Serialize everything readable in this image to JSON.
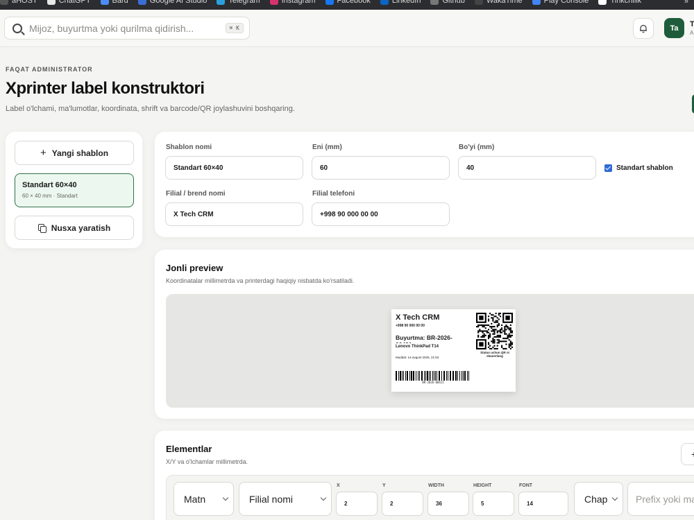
{
  "bookmarks": [
    {
      "label": "aHOST",
      "color": "#555555"
    },
    {
      "label": "ChatGPT",
      "color": "#e8e8e8"
    },
    {
      "label": "Bard",
      "color": "#4b8df8"
    },
    {
      "label": "Google AI Studio",
      "color": "#3b6fd8"
    },
    {
      "label": "Telegram",
      "color": "#2aa1de"
    },
    {
      "label": "Instagram",
      "color": "#d6336c"
    },
    {
      "label": "Facebook",
      "color": "#1877f2"
    },
    {
      "label": "LinkedIn",
      "color": "#0a66c2"
    },
    {
      "label": "Github",
      "color": "#777777"
    },
    {
      "label": "WakaTime",
      "color": "#444444"
    },
    {
      "label": "Play Console",
      "color": "#4285f4"
    },
    {
      "label": "Tinkchilik",
      "color": "#ffffff"
    }
  ],
  "bookmarks_overflow": "»",
  "topbar": {
    "search_placeholder": "Mijoz, buyurtma yoki qurilma qidirish...",
    "search_shortcut": "⌘ K",
    "avatar_initials": "Ta",
    "user_name": "T",
    "user_role": "A"
  },
  "header": {
    "eyebrow": "FAQAT ADMINISTRATOR",
    "title": "Xprinter label konstruktori",
    "subtitle": "Label o'lchami, ma'lumotlar, koordinata, shrift va barcode/QR joylashuvini boshqaring."
  },
  "left_panel": {
    "new_template_label": "Yangi shablon",
    "template": {
      "name": "Standart 60×40",
      "meta": "60 × 40 mm · Standart"
    },
    "duplicate_label": "Nusxa yaratish"
  },
  "form": {
    "name_label": "Shablon nomi",
    "name_value": "Standart 60×40",
    "width_label": "Eni (mm)",
    "width_value": "60",
    "height_label": "Bo'yi (mm)",
    "height_value": "40",
    "default_label": "Standart shablon",
    "default_checked": true,
    "brand_label": "Filial / brend nomi",
    "brand_value": "X Tech CRM",
    "phone_label": "Filial telefoni",
    "phone_value": "+998 90 000 00 00"
  },
  "preview": {
    "title": "Jonli preview",
    "subtitle": "Koordinatalar millimetrda va printerdagi haqiqiy nisbatda ko'rsatiladi.",
    "label": {
      "brand": "X Tech CRM",
      "phone": "+998 90 000 00 00",
      "order": "Buyurtma: BR-2026-00421",
      "product": "Lenovo ThinkPad T14",
      "due": "Muddat: 14-avgust 2026, 21:53",
      "qr_caption": "Status uchun QR ni skanerlang",
      "barcode_text": "BR-2026-00421"
    }
  },
  "elements": {
    "title": "Elementlar",
    "subtitle": "X/Y va o'lchamlar millimetrda.",
    "add_label": "+",
    "row": {
      "type": "Matn",
      "field": "Filial nomi",
      "x_label": "X",
      "x_value": "2",
      "y_label": "Y",
      "y_value": "2",
      "width_label": "WIDTH",
      "width_value": "36",
      "height_label": "HEIGHT",
      "height_value": "5",
      "font_label": "FONT",
      "font_value": "14",
      "align": "Chap",
      "prefix_placeholder": "Prefix yoki matn"
    }
  },
  "colors": {
    "accent": "#1f5c3b",
    "selected_bg": "#ecf8ef",
    "checkbox": "#2f6ad8"
  }
}
